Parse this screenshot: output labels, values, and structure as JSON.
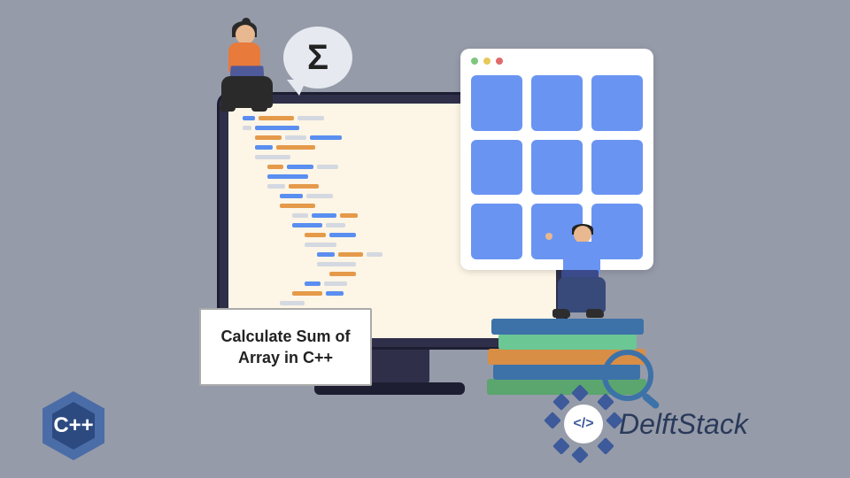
{
  "card": {
    "title": "Calculate Sum of Array in C++"
  },
  "sigma": {
    "symbol": "Σ"
  },
  "cpp_logo": {
    "label": "C++"
  },
  "delftstack": {
    "code_glyph": "</>",
    "brand": "DelftStack"
  },
  "colors": {
    "bg": "#969ba9",
    "accent_blue": "#6a94f2",
    "monitor": "#2f2f4a"
  }
}
